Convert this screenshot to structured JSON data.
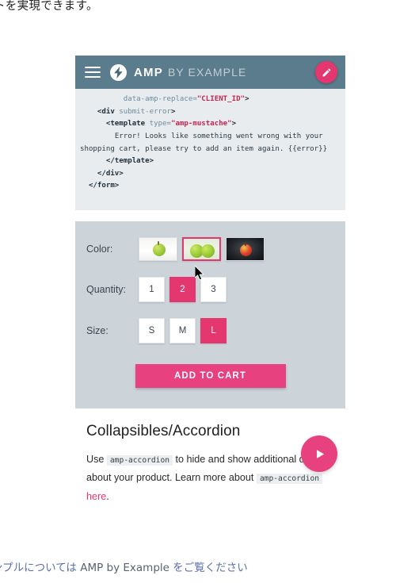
{
  "page": {
    "top_caption": " トを実現できます。",
    "bottom_caption_pre": "ンプルについては ",
    "bottom_caption_latin": "AMP by Example",
    "bottom_caption_post": " をご覧ください"
  },
  "colors": {
    "header_bg": "#5b7c8d",
    "accent_pink": "#e5376f",
    "button_pink": "#e8417f",
    "code_bg": "#e9ecef",
    "form_bg": "#ccd4da",
    "link_blue": "#5b6fa8"
  },
  "header": {
    "menu_icon": "hamburger-menu-icon",
    "logo_icon": "amp-lightning-bolt-icon",
    "brand": "AMP",
    "brand_sub": "BY EXAMPLE",
    "edit_icon": "pencil-edit-icon"
  },
  "code": {
    "lines": [
      [
        {
          "t": "",
          "cls": "indent",
          "text": "          "
        },
        {
          "t": "attr",
          "text": "data-amp-replace="
        },
        {
          "t": "str",
          "text": "\"CLIENT_ID\""
        },
        {
          "t": "tag",
          "text": ">"
        }
      ],
      [
        {
          "t": "",
          "cls": "indent",
          "text": "    "
        },
        {
          "t": "tag",
          "text": "<div "
        },
        {
          "t": "attr",
          "text": "submit-error"
        },
        {
          "t": "tag",
          "text": ">"
        }
      ],
      [
        {
          "t": "",
          "cls": "indent",
          "text": "      "
        },
        {
          "t": "tag",
          "text": "<template "
        },
        {
          "t": "attr",
          "text": "type="
        },
        {
          "t": "str",
          "text": "\"amp-mustache\""
        },
        {
          "t": "tag",
          "text": ">"
        }
      ],
      [
        {
          "t": "",
          "cls": "indent",
          "text": "        "
        },
        {
          "t": "txt",
          "text": "Error! Looks like something went wrong with your shopping cart, please try to add an item again. {{error}}"
        }
      ],
      [
        {
          "t": "",
          "cls": "indent",
          "text": "      "
        },
        {
          "t": "tag",
          "text": "</template>"
        }
      ],
      [
        {
          "t": "",
          "cls": "indent",
          "text": "    "
        },
        {
          "t": "tag",
          "text": "</div>"
        }
      ],
      [
        {
          "t": "",
          "cls": "indent",
          "text": "  "
        },
        {
          "t": "tag",
          "text": "</form>"
        }
      ]
    ]
  },
  "product_form": {
    "color": {
      "label": "Color:",
      "options": [
        {
          "name": "green-apple-white-bg",
          "selected": false
        },
        {
          "name": "two-green-apples",
          "selected": true
        },
        {
          "name": "red-apple-dark-bg",
          "selected": false
        }
      ]
    },
    "quantity": {
      "label": "Quantity:",
      "options": [
        {
          "value": "1",
          "selected": false
        },
        {
          "value": "2",
          "selected": true
        },
        {
          "value": "3",
          "selected": false
        }
      ]
    },
    "size": {
      "label": "Size:",
      "options": [
        {
          "value": "S",
          "selected": false
        },
        {
          "value": "M",
          "selected": false
        },
        {
          "value": "L",
          "selected": true
        }
      ]
    },
    "add_to_cart_label": "ADD TO CART"
  },
  "accordion": {
    "title": "Collapsibles/Accordion",
    "body_1": "Use ",
    "code_1": "amp-accordion",
    "body_2": " to hide and show additional details about your product. Learn more about ",
    "code_2": "amp-accordion",
    "body_3": " ",
    "link_text": "here",
    "body_4": ".",
    "play_icon": "play-triangle-icon"
  }
}
